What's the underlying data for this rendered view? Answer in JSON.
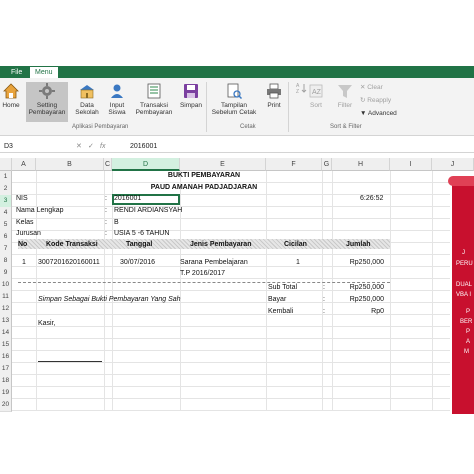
{
  "tabs": {
    "file": "File",
    "menu": "Menu"
  },
  "ribbon": {
    "home": "Home",
    "setting": [
      "Setting",
      "Pembayaran"
    ],
    "data_sekolah": [
      "Data",
      "Sekolah"
    ],
    "input_siswa": [
      "Input",
      "Siswa"
    ],
    "transaksi": [
      "Transaksi",
      "Pembayaran"
    ],
    "simpan": "Simpan",
    "tampilan": "Tampilan",
    "sebelum_cetak": "Sebelum Cetak",
    "print": "Print",
    "sort": "Sort",
    "filter": "Filter",
    "clear": "Clear",
    "reapply": "Reapply",
    "advanced": "Advanced",
    "group_aplikasi": "Aplikasi Pembayaran",
    "group_cetak": "Cetak",
    "group_sort": "Sort & Filter"
  },
  "formula_bar": {
    "name_box": "D3",
    "value": "2016001"
  },
  "columns": [
    "A",
    "B",
    "C",
    "D",
    "E",
    "F",
    "G",
    "H",
    "I",
    "J"
  ],
  "rows": [
    "1",
    "2",
    "3",
    "4",
    "5",
    "6",
    "7",
    "8",
    "9",
    "10",
    "11",
    "12",
    "13",
    "14",
    "15",
    "16",
    "17",
    "18",
    "19",
    "20"
  ],
  "receipt": {
    "title": "BUKTI PEMBAYARAN",
    "school": "PAUD AMANAH PADJADJARAN",
    "nis_label": "NIS",
    "nis_value": "2016001",
    "time": "6:26:52",
    "nama_label": "Nama Lengkap",
    "nama_value": "RENDI ARDIANSYAH",
    "kelas_label": "Kelas",
    "kelas_value": "B",
    "jurusan_label": "Jurusan",
    "jurusan_value": "USIA 5 -6 TAHUN",
    "colon": ":",
    "table_headers": [
      "No",
      "Kode Transaksi",
      "Tanggal",
      "Jenis Pembayaran",
      "Cicilan",
      "Jumlah"
    ],
    "table_row": {
      "no": "1",
      "kode": "3007201620160011",
      "tanggal": "30/07/2016",
      "jenis_line1": "Sarana Pembelajaran",
      "jenis_line2": "T.P 2016/2017",
      "cicilan": "1",
      "jumlah": "Rp250,000"
    },
    "note": "Simpan Sebagai Bukti Pembayaran Yang Sah",
    "kasir": "Kasir,",
    "sub_total_label": "Sub Total",
    "sub_total_value": "Rp250,000",
    "bayar_label": "Bayar",
    "bayar_value": "Rp250,000",
    "kembali_label": "Kembali",
    "kembali_value": "Rp0"
  },
  "side_banner_fragments": [
    "J",
    "PERU",
    "DUAL",
    "VBA I",
    "P",
    "BER",
    "P",
    "A",
    "M"
  ],
  "colors": {
    "accent": "#217346",
    "banner": "#c8102e"
  }
}
